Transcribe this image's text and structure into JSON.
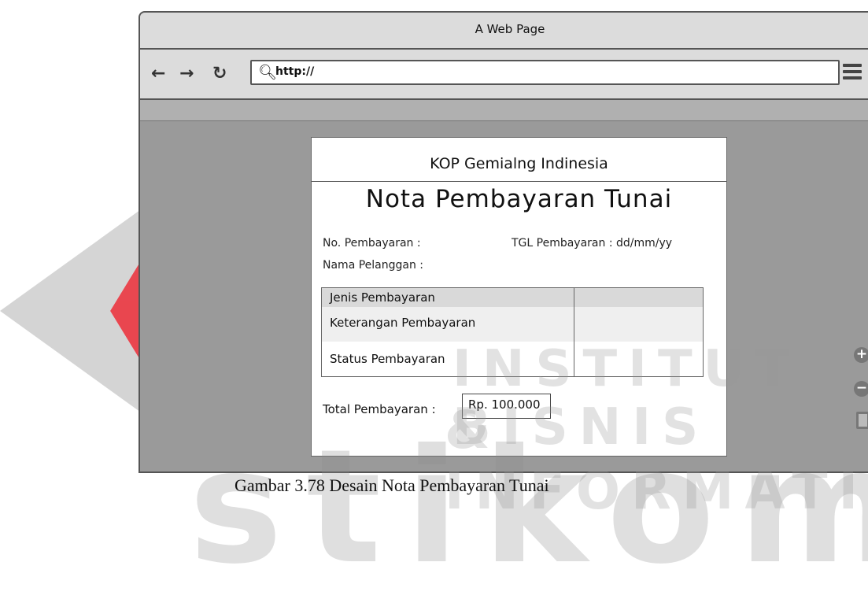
{
  "browser": {
    "title": "A Web Page",
    "back": "←",
    "forward": "→",
    "reload": "↻",
    "url": "http://",
    "search_icon": "magnifier-icon",
    "menu_icon": "hamburger-icon"
  },
  "nota": {
    "header": "KOP Gemialng Indinesia",
    "title": "Nota Pembayaran Tunai",
    "no_pembayaran_label": "No. Pembayaran :",
    "tgl_pembayaran_label": "TGL Pembayaran : dd/mm/yy",
    "nama_pelanggan_label": "Nama Pelanggan :",
    "table_rows": [
      {
        "label": "Jenis Pembayaran",
        "value": ""
      },
      {
        "label": "Keterangan Pembayaran",
        "value": ""
      },
      {
        "label": "Status Pembayaran",
        "value": ""
      }
    ],
    "total_label": "Total Pembayaran :",
    "total_value": "Rp. 100.000"
  },
  "side_icons": {
    "zoom_in": "+",
    "zoom_out": "−"
  },
  "watermark": {
    "line1": "INSTITUT BISNIS",
    "line2": "& INFORMATIKA",
    "brand": "stikom"
  },
  "caption": "Gambar 3.78 Desain Nota Pembayaran Tunai",
  "colors": {
    "watermark_red": "#e7333d",
    "frame_gray": "#9a9a9a"
  }
}
